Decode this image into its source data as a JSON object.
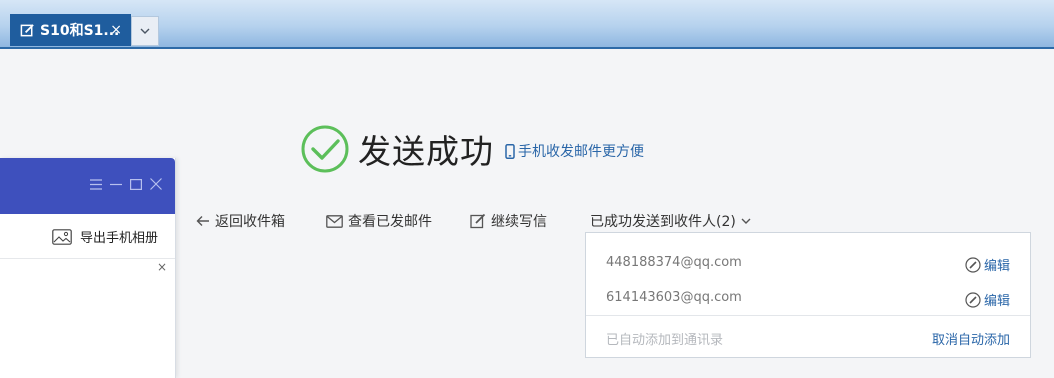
{
  "tab_bar": {
    "tab_title": "S10和S1...",
    "close_glyph": "×",
    "dropdown_glyph": "⌄"
  },
  "success": {
    "title": "发送成功",
    "phone_link": "手机收发邮件更方便",
    "accent_color": "#5cbf5a"
  },
  "actions": {
    "back": "返回收件箱",
    "view_sent": "查看已发邮件",
    "continue_write": "继续写信",
    "sent_to": "已成功发送到收件人(2)"
  },
  "recipients": {
    "items": [
      {
        "email": "448188374@qq.com",
        "edit_label": "编辑"
      },
      {
        "email": "614143603@qq.com",
        "edit_label": "编辑"
      }
    ],
    "auto_added": "已自动添加到通讯录",
    "cancel_auto": "取消自动添加"
  },
  "side_panel": {
    "export_label": "导出手机相册",
    "close_glyph": "×",
    "header_color": "#3e50bd"
  }
}
